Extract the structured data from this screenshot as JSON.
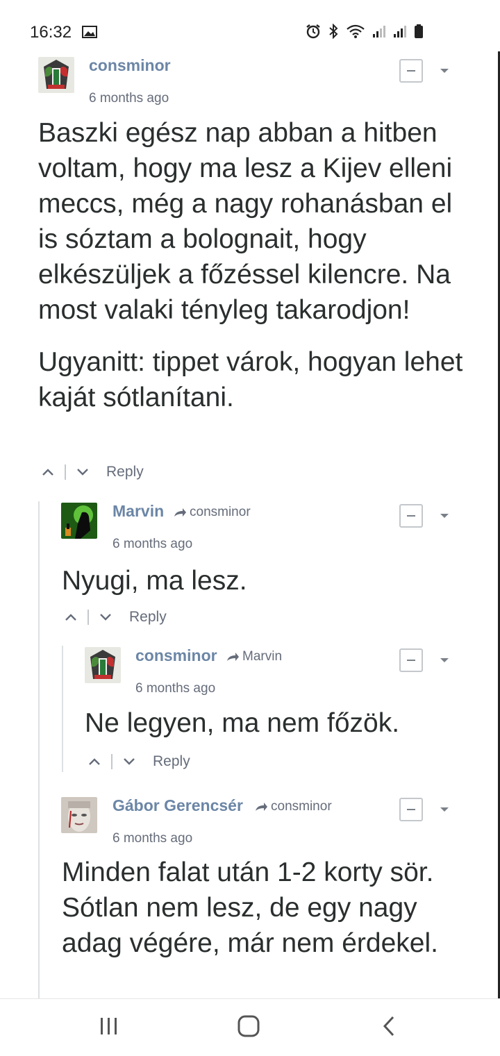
{
  "status_bar": {
    "time": "16:32",
    "icons": [
      "image-icon",
      "alarm-icon",
      "bluetooth-icon",
      "wifi-icon",
      "signal-icon",
      "signal-icon",
      "battery-icon"
    ]
  },
  "comments": [
    {
      "author": "consminor",
      "reply_to": "",
      "timestamp": "6 months ago",
      "paragraphs": [
        "Baszki egész nap abban a hitben voltam, hogy ma lesz a Kijev elleni meccs, még a nagy rohanásban el is sóztam a bolognait, hogy elkészüljek a főzéssel kilencre. Na most valaki tényleg takarodjon!",
        "Ugyanitt: tippet várok, hogyan lehet kaját sótlanítani."
      ],
      "reply_label": "Reply"
    },
    {
      "author": "Marvin",
      "reply_to": "consminor",
      "timestamp": "6 months ago",
      "paragraphs": [
        "Nyugi, ma lesz."
      ],
      "reply_label": "Reply"
    },
    {
      "author": "consminor",
      "reply_to": "Marvin",
      "timestamp": "6 months ago",
      "paragraphs": [
        "Ne legyen, ma nem főzök."
      ],
      "reply_label": "Reply"
    },
    {
      "author": "Gábor Gerencsér",
      "reply_to": "consminor",
      "timestamp": "6 months ago",
      "paragraphs": [
        "Minden falat után 1-2 korty sör. Sótlan nem lesz, de egy nagy adag végére, már nem érdekel."
      ],
      "reply_label": ""
    }
  ],
  "colors": {
    "author": "#6b86a6",
    "meta": "#656c7a",
    "text": "#2a2e2e",
    "thread_line": "#dde1e4"
  },
  "nav_bar": {
    "icons": [
      "recent-apps-icon",
      "home-icon",
      "back-icon"
    ]
  }
}
